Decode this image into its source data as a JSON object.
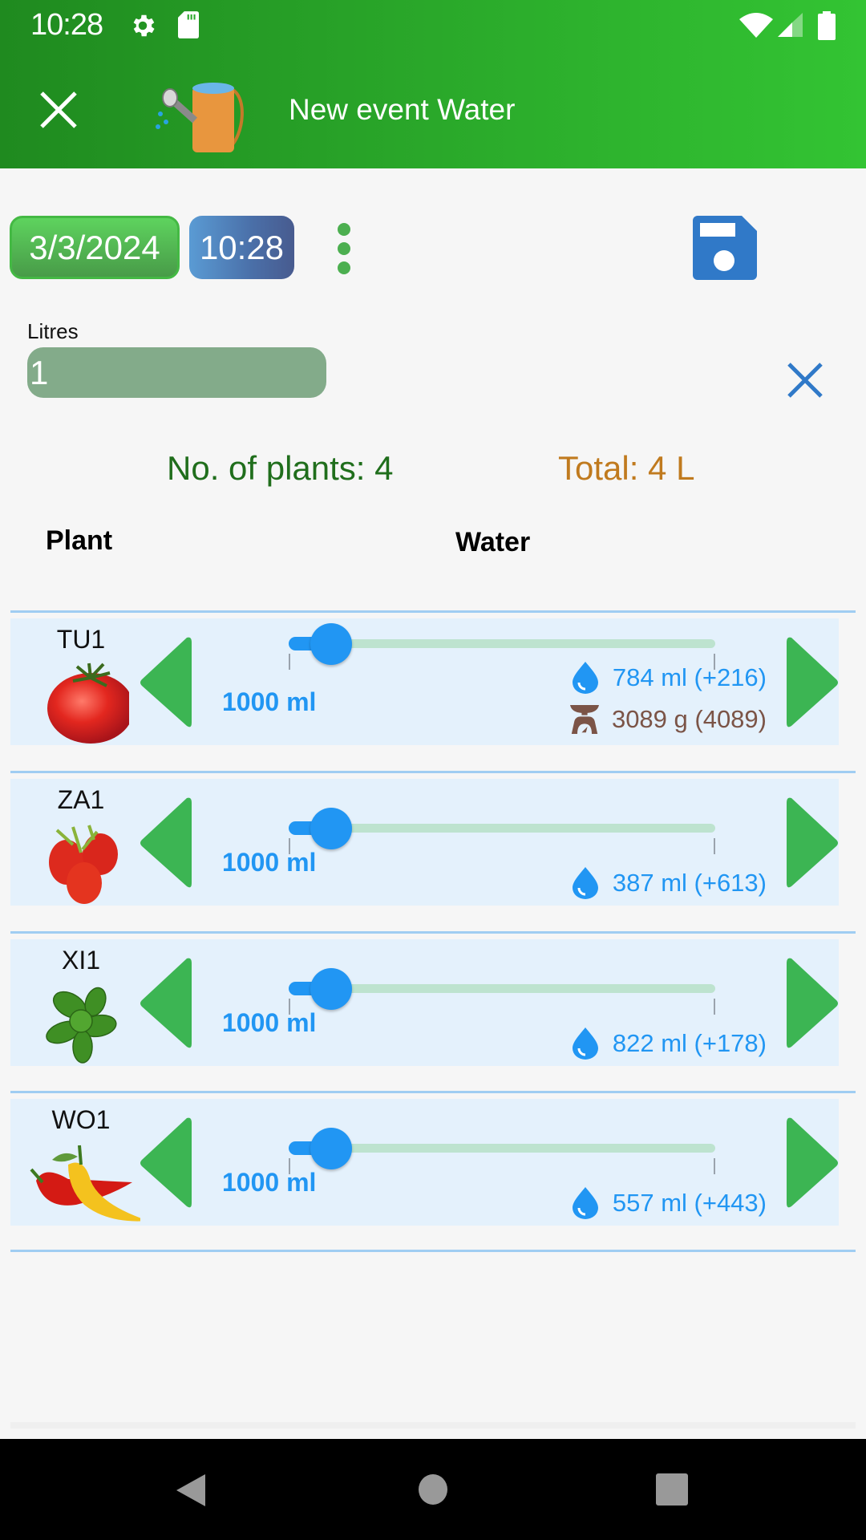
{
  "status_bar": {
    "time": "10:28",
    "icons": [
      "gear-icon",
      "sd-card-icon",
      "wifi-icon",
      "signal-icon",
      "battery-icon"
    ]
  },
  "app_bar": {
    "title": "New event Water",
    "close_icon": "close-icon",
    "event_icon": "watering-can-icon",
    "colors": {
      "gradient_start": "#1f8a1f",
      "gradient_end": "#33c433"
    }
  },
  "toolbar": {
    "date": "3/3/2024",
    "time": "10:28",
    "more_icon": "more-vert-icon",
    "save_icon": "save-icon"
  },
  "litres_field": {
    "label": "Litres",
    "value": "1",
    "clear_icon": "close-icon"
  },
  "summary": {
    "plants_count": "No. of plants: 4",
    "total": "Total: 4 L"
  },
  "table": {
    "headers": {
      "plant": "Plant",
      "water": "Water"
    },
    "rows": [
      {
        "code": "TU1",
        "image": "tomato-icon",
        "amount": "1000 ml",
        "slider_fraction": 0.1,
        "water_info": "784 ml (+216)",
        "weight_info": "3089 g (4089)"
      },
      {
        "code": "ZA1",
        "image": "cherry-tomatoes-icon",
        "amount": "1000 ml",
        "slider_fraction": 0.1,
        "water_info": "387 ml (+613)"
      },
      {
        "code": "XI1",
        "image": "basil-icon",
        "amount": "1000 ml",
        "slider_fraction": 0.1,
        "water_info": "822 ml (+178)"
      },
      {
        "code": "WO1",
        "image": "chili-peppers-icon",
        "amount": "1000 ml",
        "slider_fraction": 0.1,
        "water_info": "557 ml (+443)"
      }
    ]
  },
  "colors": {
    "accent_blue": "#2196f3",
    "arrow_green": "#3cb553",
    "weight_brown": "#7b5447",
    "plants_green": "#206e1c",
    "total_orange": "#c07a1e"
  },
  "nav_bar": {
    "buttons": [
      "back-icon",
      "home-icon",
      "recents-icon"
    ]
  }
}
